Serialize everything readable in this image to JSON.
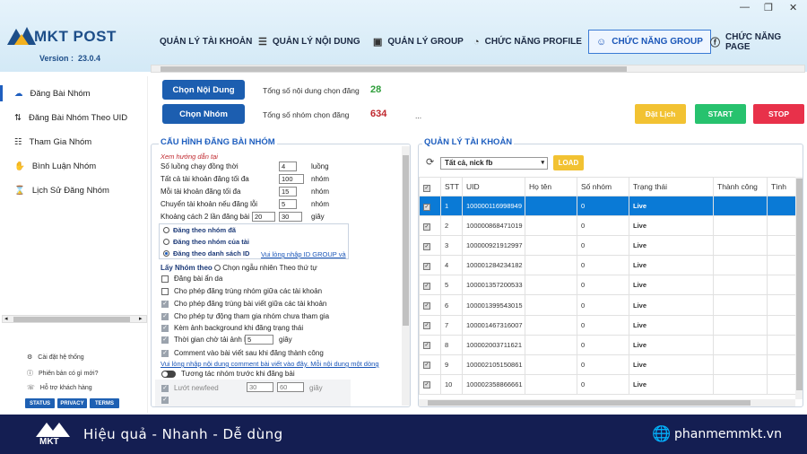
{
  "app": {
    "logo_text": "MKT POST",
    "version_label": "Version :",
    "version": "23.0.4"
  },
  "nav_tabs": [
    {
      "label": "QUẢN LÝ TÀI KHOẢN",
      "icon": "none"
    },
    {
      "label": "QUẢN LÝ NỘI DUNG",
      "icon": "list-icon"
    },
    {
      "label": "QUẢN LÝ GROUP",
      "icon": "window-icon"
    },
    {
      "label": "CHỨC NĂNG PROFILE",
      "icon": "signal-icon"
    },
    {
      "label": "CHỨC NĂNG GROUP",
      "icon": "group-icon",
      "active": true
    },
    {
      "label": "CHỨC NĂNG PAGE",
      "icon": "facebook-icon"
    }
  ],
  "sidebar": {
    "items": [
      {
        "label": "Đăng Bài Nhóm",
        "icon": "cloud-upload-icon",
        "active": true
      },
      {
        "label": "Đăng Bài Nhóm Theo UID",
        "icon": "arrows-icon"
      },
      {
        "label": "Tham Gia Nhóm",
        "icon": "group-icon"
      },
      {
        "label": "Bình Luận Nhóm",
        "icon": "hand-icon"
      },
      {
        "label": "Lịch Sử Đăng Nhóm",
        "icon": "hourglass-icon"
      }
    ],
    "footer_links": [
      {
        "label": "Cài đặt hệ thống",
        "icon": "gear-icon"
      },
      {
        "label": "Phiên bản có gì mới?",
        "icon": "info-icon"
      },
      {
        "label": "Hỗ trợ khách hàng",
        "icon": "support-icon"
      }
    ],
    "footer_buttons": [
      "STATUS",
      "PRIVACY",
      "TERMS"
    ]
  },
  "actions": {
    "choose_content": "Chọn Nội Dung",
    "choose_group": "Chọn Nhóm",
    "content_count_label": "Tổng số nội dung chọn đăng",
    "content_count": "28",
    "group_count_label": "Tổng số nhóm chọn đăng",
    "group_count": "634",
    "ellipsis": "...",
    "schedule": "Đặt Lịch",
    "start": "START",
    "stop": "STOP"
  },
  "config": {
    "title": "CẤU HÌNH ĐĂNG BÀI NHÓM",
    "guide_link": "Xem hướng dẫn tại",
    "rows": [
      {
        "label": "Số luồng chạy đồng thời",
        "value": "4",
        "unit": "luồng"
      },
      {
        "label": "Tất cả tài khoản đăng tối đa",
        "value": "100",
        "unit": "nhóm"
      },
      {
        "label": "Mỗi tài khoản đăng tối đa",
        "value": "15",
        "unit": "nhóm"
      },
      {
        "label": "Chuyển tài khoản nếu đăng lỗi",
        "value": "5",
        "unit": "nhóm"
      }
    ],
    "delay_label": "Khoảng cách 2 lần đăng bài",
    "delay_from": "20",
    "delay_to": "30",
    "delay_unit": "giây",
    "radios": [
      {
        "label": "Đăng theo nhóm đã",
        "checked": false
      },
      {
        "label": "Đăng theo nhóm của tài",
        "checked": false
      },
      {
        "label": "Đăng theo danh sách ID",
        "checked": true
      }
    ],
    "id_group_link": "Vui lòng nhập ID GROUP và",
    "pick_label": "Lấy Nhóm theo",
    "pick_random": "Chọn ngẫu nhiên",
    "pick_order": "Theo thứ tự",
    "checks": [
      {
        "label": "Đăng bài ẩn da",
        "checked": false
      },
      {
        "label": "Cho phép đăng trùng nhóm giữa các tài khoản",
        "checked": false
      },
      {
        "label": "Cho phép đăng trùng bài viết giữa các tài khoản",
        "checked": true
      },
      {
        "label": "Cho phép tự động tham gia nhóm chưa tham gia",
        "checked": true
      },
      {
        "label": "Kèm ảnh background khi đăng trạng thái",
        "checked": true
      },
      {
        "label": "Thời gian chờ tải ảnh lên",
        "checked": true,
        "value": "5",
        "unit": "giây"
      },
      {
        "label": "Comment vào bài viết sau khi đăng thành công",
        "checked": true
      }
    ],
    "comment_link": "Vui lòng nhập nội dung comment bài viết vào đây. Mỗi nội dung một dòng",
    "interact_label": "Tương tác nhóm trước khi đăng bài",
    "newsfeed_label": "Lướt newfeed",
    "newsfeed_from": "30",
    "newsfeed_to": "60",
    "newsfeed_unit": "giây"
  },
  "accounts": {
    "title": "QUẢN LÝ TÀI KHOẢN",
    "filter": "Tất cả, nick fb",
    "load": "LOAD",
    "columns": [
      "STT",
      "UID",
      "Họ tên",
      "Số nhóm",
      "Trạng thái",
      "Thành công",
      "Tình"
    ],
    "rows": [
      {
        "stt": "1",
        "uid": "100000116998949",
        "name": "",
        "groups": "0",
        "status": "Live",
        "selected": true
      },
      {
        "stt": "2",
        "uid": "100000868471019",
        "name": "",
        "groups": "0",
        "status": "Live"
      },
      {
        "stt": "3",
        "uid": "100000921912997",
        "name": "",
        "groups": "0",
        "status": "Live"
      },
      {
        "stt": "4",
        "uid": "100001284234182",
        "name": "",
        "groups": "0",
        "status": "Live"
      },
      {
        "stt": "5",
        "uid": "100001357200533",
        "name": "",
        "groups": "0",
        "status": "Live"
      },
      {
        "stt": "6",
        "uid": "100001399543015",
        "name": "",
        "groups": "0",
        "status": "Live"
      },
      {
        "stt": "7",
        "uid": "100001467316007",
        "name": "",
        "groups": "0",
        "status": "Live"
      },
      {
        "stt": "8",
        "uid": "100002003711621",
        "name": "",
        "groups": "0",
        "status": "Live"
      },
      {
        "stt": "9",
        "uid": "100002105150861",
        "name": "",
        "groups": "0",
        "status": "Live"
      },
      {
        "stt": "10",
        "uid": "100002358866661",
        "name": "",
        "groups": "0",
        "status": "Live"
      }
    ]
  },
  "banner": {
    "logo_text": "MKT",
    "slogan": "Hiệu quả - Nhanh - Dễ dùng",
    "website": "phanmemmkt.vn"
  },
  "colors": {
    "brand_blue": "#1c5eb0",
    "banner_navy": "#141e52",
    "schedule_yellow": "#f2c232",
    "start_green": "#27c26e",
    "stop_red": "#e8314a",
    "selected_row": "#0a7ad6",
    "live_green": "#2f9e3b"
  }
}
